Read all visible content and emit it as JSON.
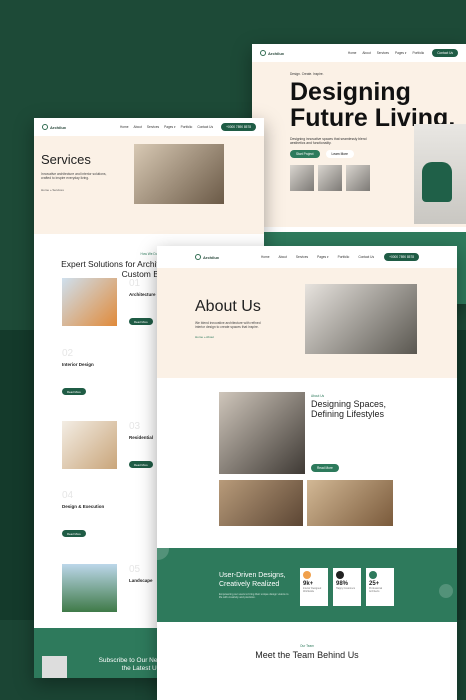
{
  "home": {
    "logo": "Archilux",
    "nav": [
      "Home",
      "About",
      "Services",
      "Pages ▾",
      "Portfolio"
    ],
    "nav_button": "Contact Us",
    "tagline": "Design. Create. Inspire.",
    "title": "Designing Future Living.",
    "subtitle": "Designing innovative spaces that seamlessly blend aesthetics and functionality.",
    "primary_button": "Start Project",
    "secondary_button": "Learn More"
  },
  "services": {
    "logo": "Archilux",
    "nav": [
      "Home",
      "About",
      "Services",
      "Pages ▾",
      "Portfolio",
      "Contact Us"
    ],
    "nav_button": "+0000 7890 8578",
    "title": "Services",
    "description": "Innovative architecture and interior solutions, crafted to inspire everyday living.",
    "breadcrumb": "Home  »  Services",
    "kicker": "How We Do",
    "heading": "Expert Solutions for Architecture, Interiors, and Custom Builds",
    "items": [
      {
        "num": "01",
        "title": "Architecture",
        "button": "Read More"
      },
      {
        "num": "02",
        "title": "Interior Design",
        "button": "Read More"
      },
      {
        "num": "03",
        "title": "Residential",
        "button": "Read More"
      },
      {
        "num": "04",
        "title": "Design & Execution",
        "button": "Read More"
      },
      {
        "num": "05",
        "title": "Landscape",
        "button": "Read More"
      }
    ],
    "footer_heading": "Subscribe to Our Newsletter to Get the Latest Updates"
  },
  "about": {
    "logo": "Archilux",
    "nav": [
      "Home",
      "About",
      "Services",
      "Pages ▾",
      "Portfolio",
      "Contact Us"
    ],
    "nav_button": "+0000 7890 8578",
    "title": "About Us",
    "description": "We blend innovative architecture with refined interior design to create spaces that inspire.",
    "breadcrumb": "Home  »  About",
    "kicker": "About Us",
    "heading": "Designing Spaces, Defining Lifestyles",
    "read_more": "Read More",
    "stats_title": "User-Driven Designs, Creatively Realized",
    "stats_sub": "Empowering our users to bring their unique design visions to life with creativity and precision.",
    "stats": [
      {
        "value": "9k+",
        "label": "Interior Designed Worldwide"
      },
      {
        "value": "98%",
        "label": "Happy Customers"
      },
      {
        "value": "25+",
        "label": "Professional Architects"
      }
    ],
    "team_kicker": "Our Team",
    "team_title": "Meet the Team Behind Us"
  }
}
